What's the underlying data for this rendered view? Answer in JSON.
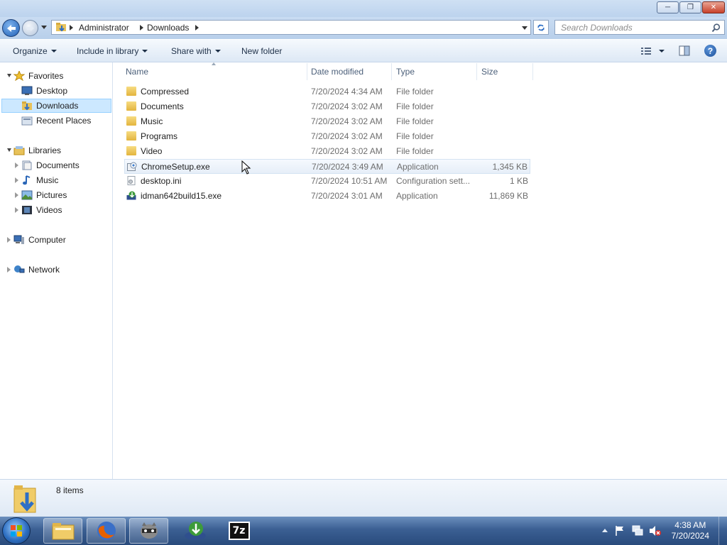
{
  "window": {
    "controls": {
      "minimize": "minimize-icon",
      "maximize": "restore-icon",
      "close": "close-icon"
    }
  },
  "address_bar": {
    "breadcrumb": [
      "Administrator",
      "Downloads"
    ],
    "refresh_icon": "refresh-icon"
  },
  "search": {
    "placeholder": "Search Downloads",
    "icon": "search-icon"
  },
  "toolbar": {
    "organize": "Organize",
    "include_in_library": "Include in library",
    "share_with": "Share with",
    "new_folder": "New folder"
  },
  "nav": {
    "favorites": {
      "label": "Favorites",
      "items": [
        "Desktop",
        "Downloads",
        "Recent Places"
      ]
    },
    "libraries": {
      "label": "Libraries",
      "items": [
        "Documents",
        "Music",
        "Pictures",
        "Videos"
      ]
    },
    "computer": "Computer",
    "network": "Network"
  },
  "columns": {
    "name": "Name",
    "date": "Date modified",
    "type": "Type",
    "size": "Size"
  },
  "files": [
    {
      "name": "Compressed",
      "date": "7/20/2024 4:34 AM",
      "type": "File folder",
      "size": "",
      "icon": "folder-icon"
    },
    {
      "name": "Documents",
      "date": "7/20/2024 3:02 AM",
      "type": "File folder",
      "size": "",
      "icon": "folder-icon"
    },
    {
      "name": "Music",
      "date": "7/20/2024 3:02 AM",
      "type": "File folder",
      "size": "",
      "icon": "folder-icon"
    },
    {
      "name": "Programs",
      "date": "7/20/2024 3:02 AM",
      "type": "File folder",
      "size": "",
      "icon": "folder-icon"
    },
    {
      "name": "Video",
      "date": "7/20/2024 3:02 AM",
      "type": "File folder",
      "size": "",
      "icon": "folder-icon"
    },
    {
      "name": "ChromeSetup.exe",
      "date": "7/20/2024 3:49 AM",
      "type": "Application",
      "size": "1,345 KB",
      "icon": "installer-icon"
    },
    {
      "name": "desktop.ini",
      "date": "7/20/2024 10:51 AM",
      "type": "Configuration sett...",
      "size": "1 KB",
      "icon": "settings-file-icon"
    },
    {
      "name": "idman642build15.exe",
      "date": "7/20/2024 3:01 AM",
      "type": "Application",
      "size": "11,869 KB",
      "icon": "idm-icon"
    }
  ],
  "status": {
    "count": "8 items"
  },
  "taskbar": {
    "apps": [
      "windows-explorer-icon",
      "firefox-icon",
      "raccoon-app-icon",
      "idm-icon",
      "7zip-icon"
    ],
    "seven_zip_label": "7z",
    "clock": {
      "time": "4:38 AM",
      "date": "7/20/2024"
    }
  },
  "colors": {
    "selection": "#cce8ff",
    "hover": "#e5eff9",
    "taskbar": "#3b5f93"
  }
}
